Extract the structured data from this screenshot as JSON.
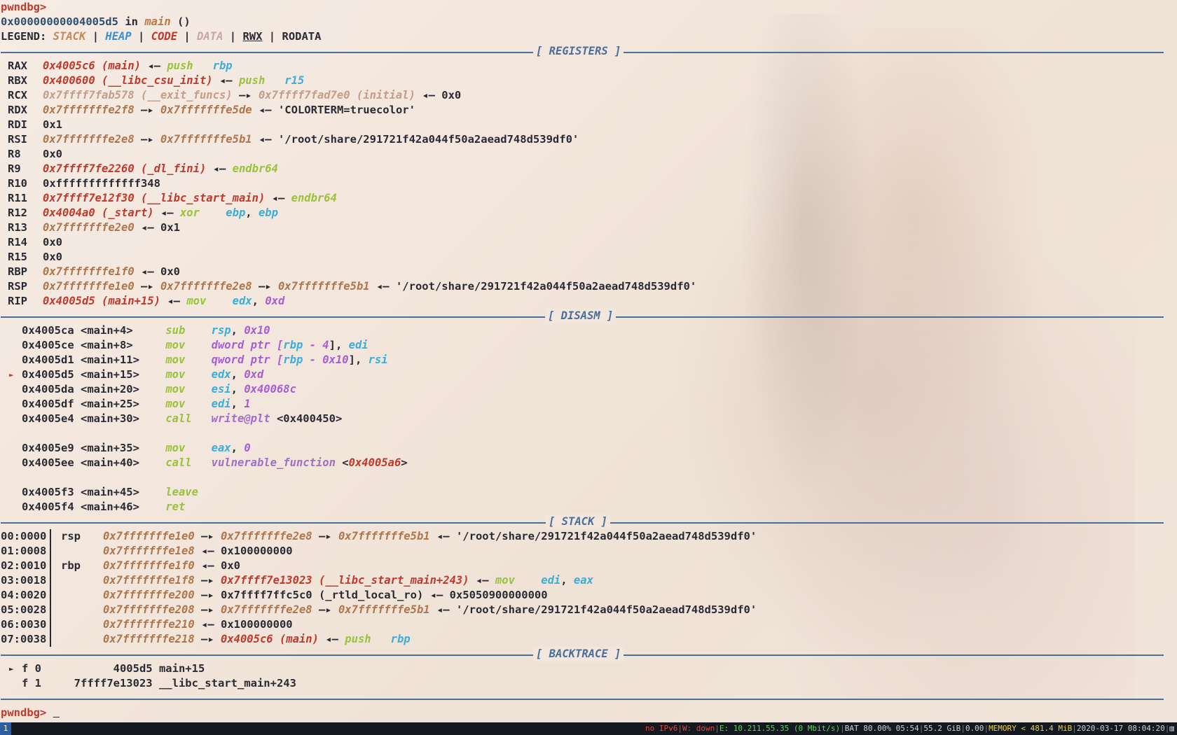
{
  "prompt": "pwndbg>",
  "location": {
    "addr": "0x00000000004005d5",
    "in": "in",
    "fn": "main",
    "paren": "()"
  },
  "legend": {
    "label": "LEGEND:",
    "stack": "STACK",
    "heap": "HEAP",
    "code": "CODE",
    "data": "DATA",
    "rwx": "RWX",
    "rodata": "RODATA",
    "sep": "|"
  },
  "sections": {
    "registers": "[ REGISTERS ]",
    "disasm": "[ DISASM ]",
    "stack": "[ STACK ]",
    "backtrace": "[ BACKTRACE ]"
  },
  "registers": [
    {
      "name": "RAX",
      "parts": [
        [
          "code",
          "0x4005c6 (main)"
        ],
        [
          "arrow",
          " ◂— "
        ],
        [
          "ins",
          "push   "
        ],
        [
          "opr",
          "rbp"
        ]
      ]
    },
    {
      "name": "RBX",
      "parts": [
        [
          "code",
          "0x400600 (__libc_csu_init)"
        ],
        [
          "arrow",
          " ◂— "
        ],
        [
          "ins",
          "push   "
        ],
        [
          "opr",
          "r15"
        ]
      ]
    },
    {
      "name": "RCX",
      "parts": [
        [
          "data",
          "0x7ffff7fab578 (__exit_funcs)"
        ],
        [
          "arrow",
          " —▸ "
        ],
        [
          "data",
          "0x7ffff7fad7e0 (initial)"
        ],
        [
          "arrow",
          " ◂— "
        ],
        [
          "plain",
          "0x0"
        ]
      ]
    },
    {
      "name": "RDX",
      "parts": [
        [
          "stk",
          "0x7fffffffe2f8"
        ],
        [
          "arrow",
          " —▸ "
        ],
        [
          "stk",
          "0x7fffffffe5de"
        ],
        [
          "arrow",
          " ◂— "
        ],
        [
          "str",
          "'COLORTERM=truecolor'"
        ]
      ]
    },
    {
      "name": "RDI",
      "parts": [
        [
          "plain",
          "0x1"
        ]
      ]
    },
    {
      "name": "RSI",
      "parts": [
        [
          "stk",
          "0x7fffffffe2e8"
        ],
        [
          "arrow",
          " —▸ "
        ],
        [
          "stk",
          "0x7fffffffe5b1"
        ],
        [
          "arrow",
          " ◂— "
        ],
        [
          "str",
          "'/root/share/291721f42a044f50a2aead748d539df0'"
        ]
      ]
    },
    {
      "name": "R8",
      "parts": [
        [
          "plain",
          "0x0"
        ]
      ]
    },
    {
      "name": "R9",
      "parts": [
        [
          "code",
          "0x7ffff7fe2260 (_dl_fini)"
        ],
        [
          "arrow",
          " ◂— "
        ],
        [
          "ins",
          "endbr64"
        ]
      ]
    },
    {
      "name": "R10",
      "parts": [
        [
          "plain",
          "0xfffffffffffff348"
        ]
      ]
    },
    {
      "name": "R11",
      "parts": [
        [
          "code",
          "0x7ffff7e12f30 (__libc_start_main)"
        ],
        [
          "arrow",
          " ◂— "
        ],
        [
          "ins",
          "endbr64"
        ]
      ]
    },
    {
      "name": "R12",
      "parts": [
        [
          "code",
          "0x4004a0 (_start)"
        ],
        [
          "arrow",
          " ◂— "
        ],
        [
          "ins",
          "xor    "
        ],
        [
          "opr",
          "ebp"
        ],
        [
          "plain",
          ", "
        ],
        [
          "opr",
          "ebp"
        ]
      ]
    },
    {
      "name": "R13",
      "parts": [
        [
          "stk",
          "0x7fffffffe2e0"
        ],
        [
          "arrow",
          " ◂— "
        ],
        [
          "plain",
          "0x1"
        ]
      ]
    },
    {
      "name": "R14",
      "parts": [
        [
          "plain",
          "0x0"
        ]
      ]
    },
    {
      "name": "R15",
      "parts": [
        [
          "plain",
          "0x0"
        ]
      ]
    },
    {
      "name": "RBP",
      "parts": [
        [
          "stk",
          "0x7fffffffe1f0"
        ],
        [
          "arrow",
          " ◂— "
        ],
        [
          "plain",
          "0x0"
        ]
      ]
    },
    {
      "name": "RSP",
      "parts": [
        [
          "stk",
          "0x7fffffffe1e0"
        ],
        [
          "arrow",
          " —▸ "
        ],
        [
          "stk",
          "0x7fffffffe2e8"
        ],
        [
          "arrow",
          " —▸ "
        ],
        [
          "stk",
          "0x7fffffffe5b1"
        ],
        [
          "arrow",
          " ◂— "
        ],
        [
          "str",
          "'/root/share/291721f42a044f50a2aead748d539df0'"
        ]
      ]
    },
    {
      "name": "RIP",
      "parts": [
        [
          "code",
          "0x4005d5 (main+15)"
        ],
        [
          "arrow",
          " ◂— "
        ],
        [
          "ins",
          "mov    "
        ],
        [
          "opr",
          "edx"
        ],
        [
          "plain",
          ", "
        ],
        [
          "num",
          "0xd"
        ]
      ]
    }
  ],
  "disasm": [
    {
      "current": false,
      "blank_after": false,
      "parts": [
        [
          "plain",
          "0x4005ca <main+4>     "
        ],
        [
          "ins",
          "sub    "
        ],
        [
          "opr",
          "rsp"
        ],
        [
          "plain",
          ", "
        ],
        [
          "num",
          "0x10"
        ]
      ]
    },
    {
      "current": false,
      "blank_after": false,
      "parts": [
        [
          "plain",
          "0x4005ce <main+8>     "
        ],
        [
          "ins",
          "mov    "
        ],
        [
          "num",
          "dword ptr ["
        ],
        [
          "opr",
          "rbp"
        ],
        [
          "num",
          " - 4"
        ],
        [
          "plain",
          "], "
        ],
        [
          "opr",
          "edi"
        ]
      ]
    },
    {
      "current": false,
      "blank_after": false,
      "parts": [
        [
          "plain",
          "0x4005d1 <main+11>    "
        ],
        [
          "ins",
          "mov    "
        ],
        [
          "num",
          "qword ptr ["
        ],
        [
          "opr",
          "rbp"
        ],
        [
          "num",
          " - 0x10"
        ],
        [
          "plain",
          "], "
        ],
        [
          "opr",
          "rsi"
        ]
      ]
    },
    {
      "current": true,
      "blank_after": false,
      "parts": [
        [
          "plain",
          "0x4005d5 <main+15>    "
        ],
        [
          "ins",
          "mov    "
        ],
        [
          "opr",
          "edx"
        ],
        [
          "plain",
          ", "
        ],
        [
          "num",
          "0xd"
        ]
      ]
    },
    {
      "current": false,
      "blank_after": false,
      "parts": [
        [
          "plain",
          "0x4005da <main+20>    "
        ],
        [
          "ins",
          "mov    "
        ],
        [
          "opr",
          "esi"
        ],
        [
          "plain",
          ", "
        ],
        [
          "num",
          "0x40068c"
        ]
      ]
    },
    {
      "current": false,
      "blank_after": false,
      "parts": [
        [
          "plain",
          "0x4005df <main+25>    "
        ],
        [
          "ins",
          "mov    "
        ],
        [
          "opr",
          "edi"
        ],
        [
          "plain",
          ", "
        ],
        [
          "num",
          "1"
        ]
      ]
    },
    {
      "current": false,
      "blank_after": true,
      "parts": [
        [
          "plain",
          "0x4005e4 <main+30>    "
        ],
        [
          "ins",
          "call   "
        ],
        [
          "fnname",
          "write@plt"
        ],
        [
          "plain",
          " <0x400450>"
        ]
      ]
    },
    {
      "current": false,
      "blank_after": false,
      "parts": [
        [
          "plain",
          "0x4005e9 <main+35>    "
        ],
        [
          "ins",
          "mov    "
        ],
        [
          "opr",
          "eax"
        ],
        [
          "plain",
          ", "
        ],
        [
          "num",
          "0"
        ]
      ]
    },
    {
      "current": false,
      "blank_after": true,
      "parts": [
        [
          "plain",
          "0x4005ee <main+40>    "
        ],
        [
          "ins",
          "call   "
        ],
        [
          "fnname",
          "vulnerable_function"
        ],
        [
          "plain",
          " <"
        ],
        [
          "code",
          "0x4005a6"
        ],
        [
          "plain",
          ">"
        ]
      ]
    },
    {
      "current": false,
      "blank_after": false,
      "parts": [
        [
          "plain",
          "0x4005f3 <main+45>    "
        ],
        [
          "ins",
          "leave  "
        ]
      ]
    },
    {
      "current": false,
      "blank_after": false,
      "parts": [
        [
          "plain",
          "0x4005f4 <main+46>    "
        ],
        [
          "ins",
          "ret    "
        ]
      ]
    }
  ],
  "stack": [
    {
      "idx": "00:0000",
      "reg": "rsp",
      "parts": [
        [
          "stk",
          "0x7fffffffe1e0"
        ],
        [
          "arrow",
          " —▸ "
        ],
        [
          "stk",
          "0x7fffffffe2e8"
        ],
        [
          "arrow",
          " —▸ "
        ],
        [
          "stk",
          "0x7fffffffe5b1"
        ],
        [
          "arrow",
          " ◂— "
        ],
        [
          "str",
          "'/root/share/291721f42a044f50a2aead748d539df0'"
        ]
      ]
    },
    {
      "idx": "01:0008",
      "reg": "",
      "parts": [
        [
          "stk",
          "0x7fffffffe1e8"
        ],
        [
          "arrow",
          " ◂— "
        ],
        [
          "plain",
          "0x100000000"
        ]
      ]
    },
    {
      "idx": "02:0010",
      "reg": "rbp",
      "parts": [
        [
          "stk",
          "0x7fffffffe1f0"
        ],
        [
          "arrow",
          " ◂— "
        ],
        [
          "plain",
          "0x0"
        ]
      ]
    },
    {
      "idx": "03:0018",
      "reg": "",
      "parts": [
        [
          "stk",
          "0x7fffffffe1f8"
        ],
        [
          "arrow",
          " —▸ "
        ],
        [
          "code",
          "0x7ffff7e13023 (__libc_start_main+243)"
        ],
        [
          "arrow",
          " ◂— "
        ],
        [
          "ins",
          "mov    "
        ],
        [
          "opr",
          "edi"
        ],
        [
          "plain",
          ", "
        ],
        [
          "opr",
          "eax"
        ]
      ]
    },
    {
      "idx": "04:0020",
      "reg": "",
      "parts": [
        [
          "stk",
          "0x7fffffffe200"
        ],
        [
          "arrow",
          " —▸ "
        ],
        [
          "plain",
          "0x7ffff7ffc5c0 (_rtld_local_ro)"
        ],
        [
          "arrow",
          " ◂— "
        ],
        [
          "plain",
          "0x5050900000000"
        ]
      ]
    },
    {
      "idx": "05:0028",
      "reg": "",
      "parts": [
        [
          "stk",
          "0x7fffffffe208"
        ],
        [
          "arrow",
          " —▸ "
        ],
        [
          "stk",
          "0x7fffffffe2e8"
        ],
        [
          "arrow",
          " —▸ "
        ],
        [
          "stk",
          "0x7fffffffe5b1"
        ],
        [
          "arrow",
          " ◂— "
        ],
        [
          "str",
          "'/root/share/291721f42a044f50a2aead748d539df0'"
        ]
      ]
    },
    {
      "idx": "06:0030",
      "reg": "",
      "parts": [
        [
          "stk",
          "0x7fffffffe210"
        ],
        [
          "arrow",
          " ◂— "
        ],
        [
          "plain",
          "0x100000000"
        ]
      ]
    },
    {
      "idx": "07:0038",
      "reg": "",
      "parts": [
        [
          "stk",
          "0x7fffffffe218"
        ],
        [
          "arrow",
          " —▸ "
        ],
        [
          "code",
          "0x4005c6 (main)"
        ],
        [
          "arrow",
          " ◂— "
        ],
        [
          "ins",
          "push   "
        ],
        [
          "opr",
          "rbp"
        ]
      ]
    }
  ],
  "backtrace": [
    {
      "current": true,
      "text": "f 0           4005d5 main+15"
    },
    {
      "current": false,
      "text": "f 1     7ffff7e13023 __libc_start_main+243"
    }
  ],
  "statusbar": {
    "workspace": "1",
    "segments": [
      [
        "red",
        "no IPv6"
      ],
      [
        "sep",
        "|"
      ],
      [
        "red",
        "W: down"
      ],
      [
        "sep",
        "|"
      ],
      [
        "green",
        "E: 10.211.55.35 (0 Mbit/s)"
      ],
      [
        "sep",
        "|"
      ],
      [
        "plain",
        "BAT 80.00% 05:54"
      ],
      [
        "sep",
        "|"
      ],
      [
        "plain",
        "55.2 GiB"
      ],
      [
        "sep",
        "|"
      ],
      [
        "plain",
        "0.00"
      ],
      [
        "sep",
        "|"
      ],
      [
        "yellow",
        "MEMORY < 481.4 MiB"
      ],
      [
        "sep",
        "|"
      ],
      [
        "plain",
        "2020-03-17 08:04:20"
      ],
      [
        "sep",
        "|"
      ],
      [
        "plain",
        "▥"
      ]
    ]
  },
  "colors": {
    "accent": "#4a6f9a",
    "code": "#c0392b",
    "stack": "#b0754a",
    "ins": "#9ac23a",
    "opr": "#3aaed8",
    "num": "#a65fd0"
  }
}
